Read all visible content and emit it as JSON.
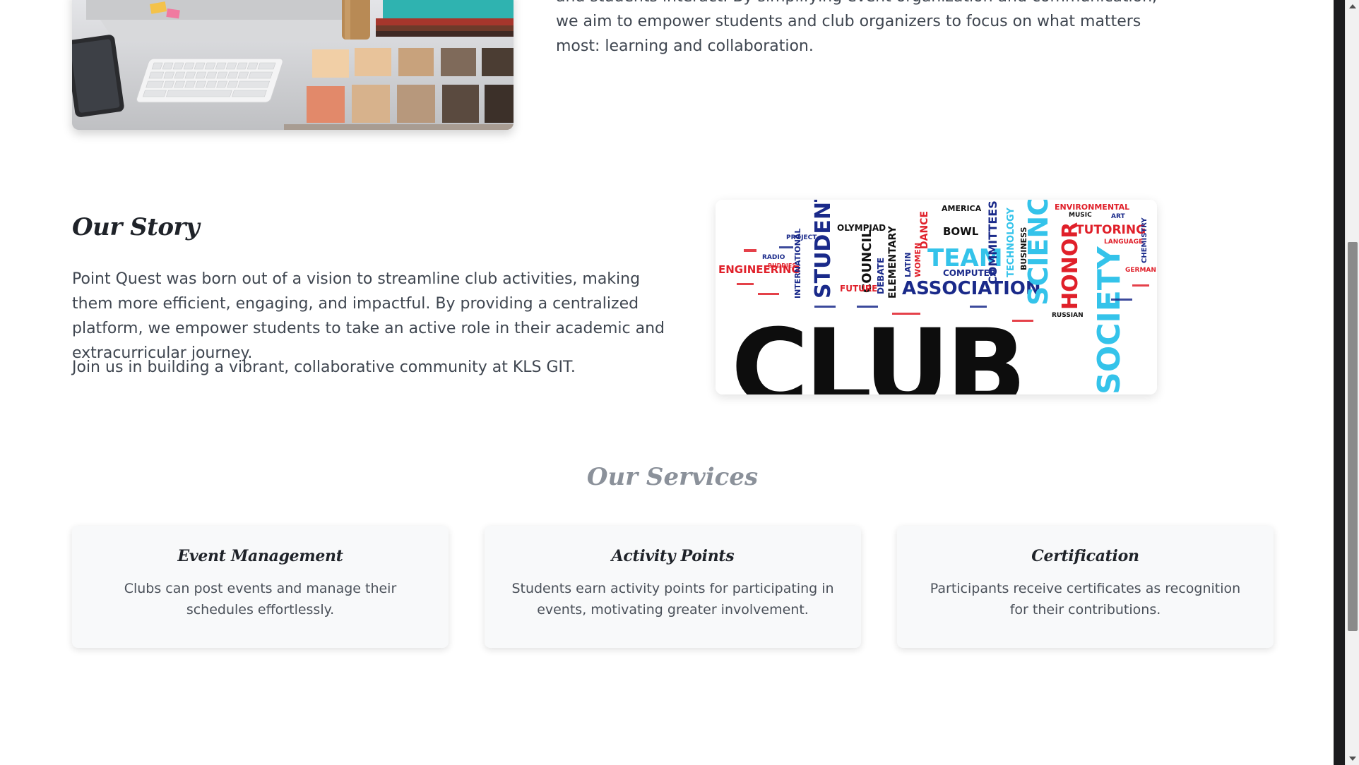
{
  "top": {
    "paragraph": "and students interact. By simplifying event organization and communication, we aim to empower students and club organizers to focus on what matters most: learning and collaboration."
  },
  "story": {
    "title": "Our Story",
    "paragraph1": "Point Quest was born out of a vision to streamline club activities, making them more efficient, engaging, and impactful. By providing a centralized platform, we empower students to take an active role in their academic and extracurricular journey.",
    "paragraph2": "Join us in building a vibrant, collaborative community at KLS GIT."
  },
  "club_image": {
    "big_word": "CLUB",
    "words": [
      "ENGINEERING",
      "STUDENT",
      "OLYMPIAD",
      "COUNCIL",
      "ELEMENTARY",
      "TEAM",
      "ASSOCIATION",
      "COMMITTEES",
      "TECHNOLOGY",
      "SCIENCE",
      "HONOR",
      "SOCIETY",
      "TUTORING",
      "ENVIRONMENTAL",
      "AMERICA",
      "BOWL",
      "DANCE",
      "COMPUTER",
      "INTERNATIONAL",
      "DEBATE",
      "FUTURE",
      "BUSINESS",
      "CHEMISTRY",
      "LANGUAGE",
      "LATIN",
      "WOMEN",
      "PROJECT",
      "RADIO",
      "BUDDIES",
      "GERMAN",
      "RUSSIAN",
      "MUSIC",
      "ART"
    ]
  },
  "services": {
    "title": "Our Services",
    "cards": [
      {
        "title": "Event Management",
        "text": "Clubs can post events and manage their schedules effortlessly."
      },
      {
        "title": "Activity Points",
        "text": "Students earn activity points for participating in events, motivating greater involvement."
      },
      {
        "title": "Certification",
        "text": "Participants receive certificates as recognition for their contributions."
      }
    ]
  },
  "scroll": {
    "position_fraction": 0.31
  }
}
